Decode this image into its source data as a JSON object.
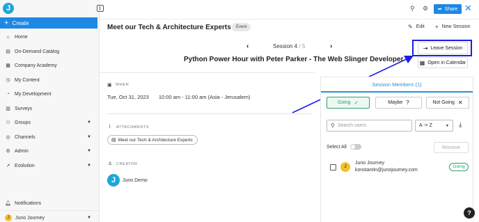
{
  "brand": {
    "logo_letter": "J"
  },
  "sidebar": {
    "create_label": "Create",
    "items": [
      {
        "label": "Home",
        "icon": "home-icon",
        "glyph": "⌂"
      },
      {
        "label": "On-Demand Catalog",
        "icon": "catalog-icon",
        "glyph": "▤"
      },
      {
        "label": "Company Academy",
        "icon": "academy-icon",
        "glyph": "▦"
      },
      {
        "label": "My Content",
        "icon": "content-icon",
        "glyph": "◷"
      },
      {
        "label": "My Development",
        "icon": "development-icon",
        "glyph": "◔"
      },
      {
        "label": "Surveys",
        "icon": "surveys-icon",
        "glyph": "▥"
      },
      {
        "label": "Groups",
        "icon": "groups-icon",
        "glyph": "⚇"
      },
      {
        "label": "Channels",
        "icon": "channels-icon",
        "glyph": "◎"
      },
      {
        "label": "Admin",
        "icon": "admin-icon",
        "glyph": "⚙"
      },
      {
        "label": "Evolution",
        "icon": "evolution-icon",
        "glyph": "↗"
      }
    ],
    "notifications_label": "Notifications",
    "user": {
      "name": "Juno Journey",
      "initial": "J"
    }
  },
  "topbar": {
    "share_label": "Share"
  },
  "header": {
    "title": "Meet our Tech & Architecture Experts",
    "badge": "Event",
    "edit_label": "Edit",
    "new_session_label": "New Session"
  },
  "session_nav": {
    "label": "Session 4",
    "total": "/ 5",
    "title": "Python Power Hour with Peter Parker - The Web Slinger Developer"
  },
  "actions": {
    "leave_label": "Leave Session",
    "calendar_label": "Open in Calendar"
  },
  "details": {
    "when_label": "WHEN",
    "date": "Tue, Oct 31, 2023",
    "time": "10:00 am - 11:00 am (Asia - Jerusalem)",
    "attachments_label": "ATTACHMENTS",
    "attachment_name": "Meet our Tech & Architecture Experts",
    "creator_label": "CREATOR",
    "creator_name": "Juno Demo",
    "creator_initial": "J"
  },
  "members": {
    "title": "Session Members (1)",
    "filters": {
      "going": "Going",
      "maybe": "Maybe",
      "not_going": "Not Going"
    },
    "search_placeholder": "Search users",
    "sort_value": "A -> Z",
    "select_all_label": "Select All",
    "remove_label": "Remove",
    "list": [
      {
        "initial": "J",
        "name": "Juno Journey",
        "email": "konstantin@junojourney.com",
        "status": "Going"
      }
    ]
  },
  "colors": {
    "accent": "#1e88e5",
    "highlight": "#1c1ce6",
    "going": "#2aa36b"
  }
}
